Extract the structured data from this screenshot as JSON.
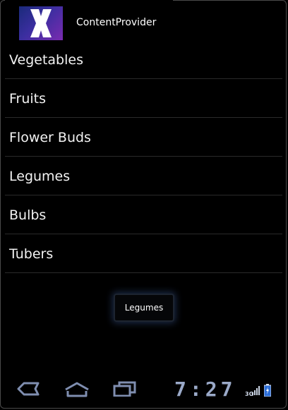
{
  "app": {
    "title": "ContentProvider",
    "icon": "x-logo-icon"
  },
  "list": {
    "items": [
      {
        "label": "Vegetables"
      },
      {
        "label": "Fruits"
      },
      {
        "label": "Flower Buds"
      },
      {
        "label": "Legumes"
      },
      {
        "label": "Bulbs"
      },
      {
        "label": "Tubers"
      }
    ]
  },
  "toast": {
    "text": "Legumes"
  },
  "status_bar": {
    "time": "7:27",
    "network": "3G"
  },
  "nav": {
    "back_icon": "back-icon",
    "home_icon": "home-icon",
    "recents_icon": "recent-apps-icon"
  },
  "colors": {
    "background": "#000000",
    "clock": "#9aa9c8",
    "nav_icon": "#7f8eb0"
  }
}
